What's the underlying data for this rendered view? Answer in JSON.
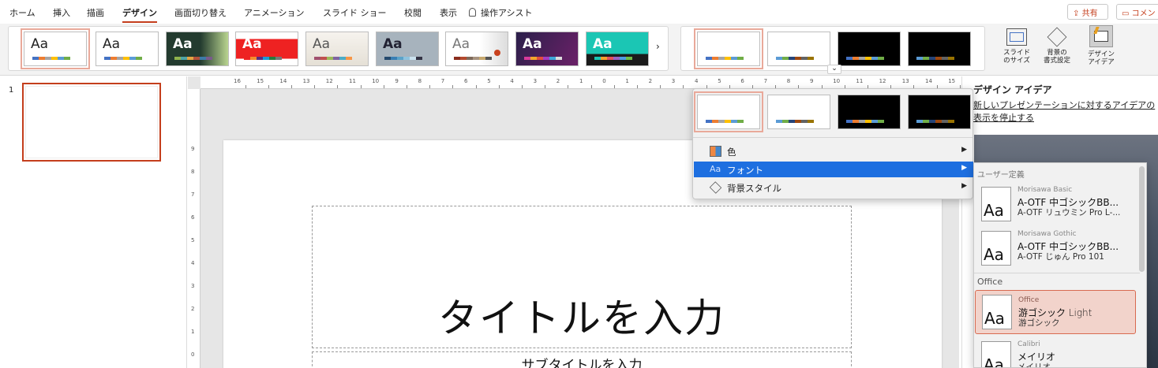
{
  "menu": {
    "tabs": [
      "ホーム",
      "挿入",
      "描画",
      "デザイン",
      "画面切り替え",
      "アニメーション",
      "スライド ショー",
      "校閲",
      "表示"
    ],
    "active_tab": "デザイン",
    "tell_me": "操作アシスト",
    "share": "共有",
    "comments": "コメン"
  },
  "ribbon": {
    "theme_aa": [
      "Aa",
      "Aa",
      "Aa",
      "Aa",
      "Aa",
      "Aa",
      "Aa",
      "Aa",
      "Aa"
    ],
    "more_arrow": "›",
    "slide_size_label_1": "スライド",
    "slide_size_label_2": "のサイズ",
    "format_bg_label_1": "背景の",
    "format_bg_label_2": "書式設定",
    "designer_label_1": "デザイン",
    "designer_label_2": "アイデア",
    "expand_arrow": "⌄"
  },
  "slides_pane": {
    "slide_number": "1"
  },
  "ruler": {
    "h_ticks": [
      "16",
      "15",
      "14",
      "13",
      "12",
      "11",
      "10",
      "9",
      "8",
      "7",
      "6",
      "5",
      "4",
      "3",
      "2",
      "1",
      "0",
      "1",
      "2",
      "3",
      "4",
      "5",
      "6",
      "7",
      "8",
      "9",
      "10",
      "11",
      "12",
      "13",
      "14",
      "15",
      "16"
    ],
    "v_ticks": [
      "9",
      "8",
      "7",
      "6",
      "5",
      "4",
      "3",
      "2",
      "1",
      "0"
    ]
  },
  "slide": {
    "title_placeholder": "タイトルを入力",
    "subtitle_placeholder": "サブタイトルを入力"
  },
  "design_ideas": {
    "title": "デザイン アイデア",
    "link_line1": "新しいプレゼンテーションに対するアイデアの",
    "link_line2": "表示を停止する"
  },
  "variants_menu": {
    "items": [
      {
        "label": "色",
        "icon": "color-icon",
        "arrow": "▶"
      },
      {
        "label": "フォント",
        "icon": "font-icon",
        "arrow": "▶"
      },
      {
        "label": "背景スタイル",
        "icon": "background-style-icon",
        "arrow": "▶"
      }
    ]
  },
  "font_submenu": {
    "section_custom": "ユーザー定義",
    "section_office": "Office",
    "sample_glyph": "Aa",
    "items": [
      {
        "name": "Morisawa Basic",
        "heading": "A-OTF 中ゴシックBB...",
        "body": "A-OTF リュウミン Pro L-..."
      },
      {
        "name": "Morisawa Gothic",
        "heading": "A-OTF 中ゴシックBB...",
        "body": "A-OTF じゅん Pro 101"
      },
      {
        "name": "Office",
        "heading": "游ゴシック Light",
        "body": "游ゴシック"
      },
      {
        "name": "Calibri",
        "heading": "メイリオ",
        "body": "メイリオ"
      }
    ]
  },
  "colors": {
    "accent": "#c43e1c",
    "highlight": "#1e6fe0",
    "palette_office": [
      "#4472c4",
      "#ed7d31",
      "#a5a5a5",
      "#ffc000",
      "#5b9bd5",
      "#70ad47"
    ]
  }
}
